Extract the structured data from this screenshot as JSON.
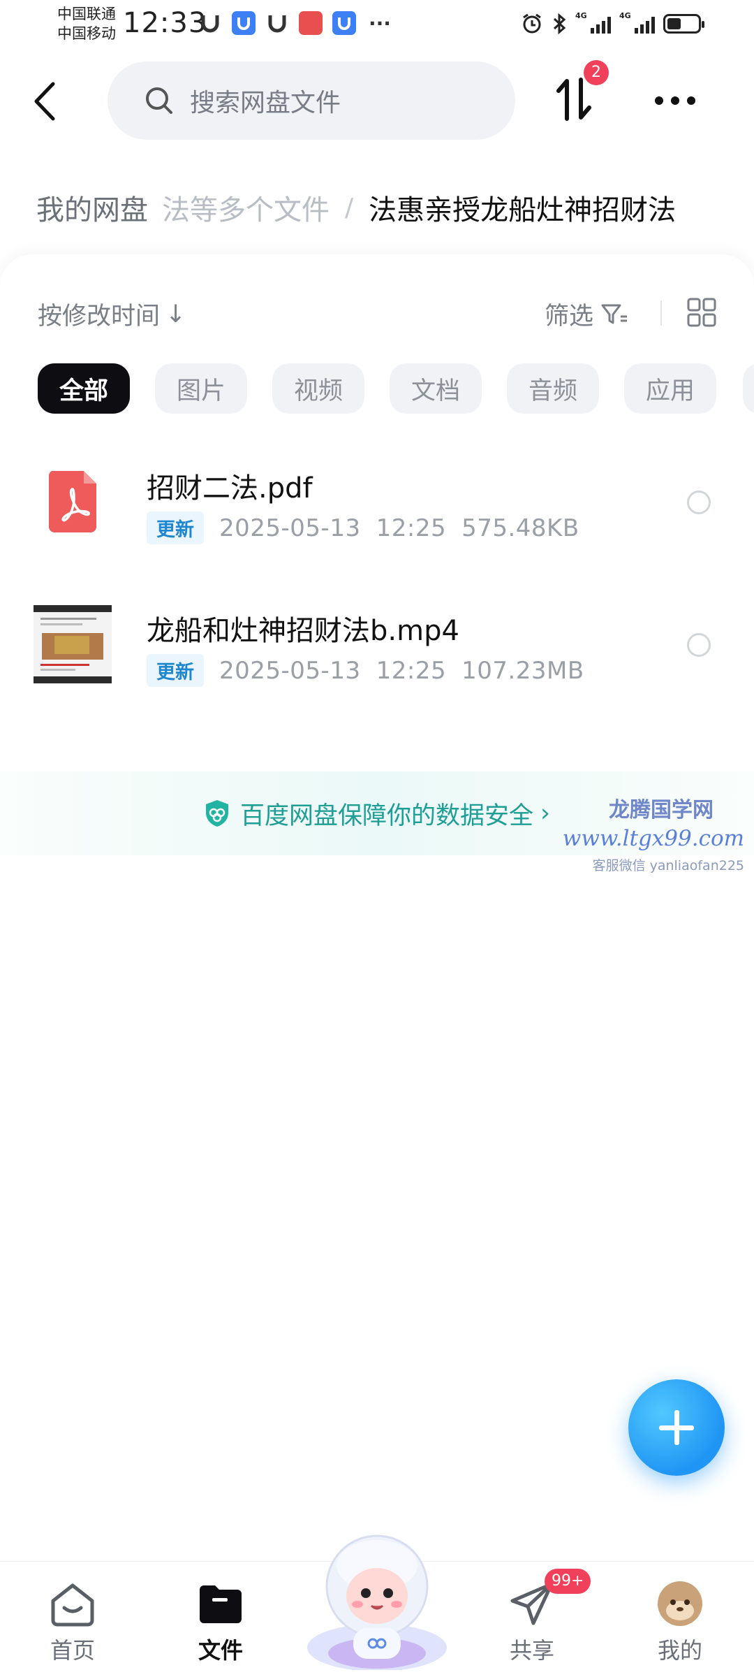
{
  "status_bar": {
    "carrier_1": "中国联通",
    "carrier_2": "中国移动",
    "time": "12:33",
    "network_1": "4G",
    "network_2": "4G",
    "battery_percent": 45
  },
  "header": {
    "search_placeholder": "搜索网盘文件",
    "transfer_badge": "2"
  },
  "breadcrumb": {
    "root": "我的网盘",
    "middle": "法等多个文件",
    "separator": "/",
    "current": "法惠亲授龙船灶神招财法"
  },
  "toolbar": {
    "sort_label": "按修改时间",
    "sort_arrow": "↓",
    "filter_label": "筛选"
  },
  "chips": [
    {
      "label": "全部",
      "active": true
    },
    {
      "label": "图片",
      "active": false
    },
    {
      "label": "视频",
      "active": false
    },
    {
      "label": "文档",
      "active": false
    },
    {
      "label": "音频",
      "active": false
    },
    {
      "label": "应用",
      "active": false
    }
  ],
  "files": [
    {
      "name": "招财二法.pdf",
      "tag": "更新",
      "date": "2025-05-13",
      "time": "12:25",
      "size": "575.48KB",
      "type": "pdf"
    },
    {
      "name": "龙船和灶神招财法b.mp4",
      "tag": "更新",
      "date": "2025-05-13",
      "time": "12:25",
      "size": "107.23MB",
      "type": "video"
    }
  ],
  "security_banner": {
    "text": "百度网盘保障你的数据安全",
    "chevron": "›"
  },
  "watermark": {
    "line1": "龙腾国学网",
    "line2": "www.ltgx99.com",
    "line3": "客服微信 yanliaofan225"
  },
  "tabbar": {
    "home": "首页",
    "files": "文件",
    "share": "共享",
    "share_badge": "99+",
    "mine": "我的"
  },
  "colors": {
    "accent": "#1f95f4",
    "badge": "#f0405a",
    "security": "#1f9e96"
  }
}
